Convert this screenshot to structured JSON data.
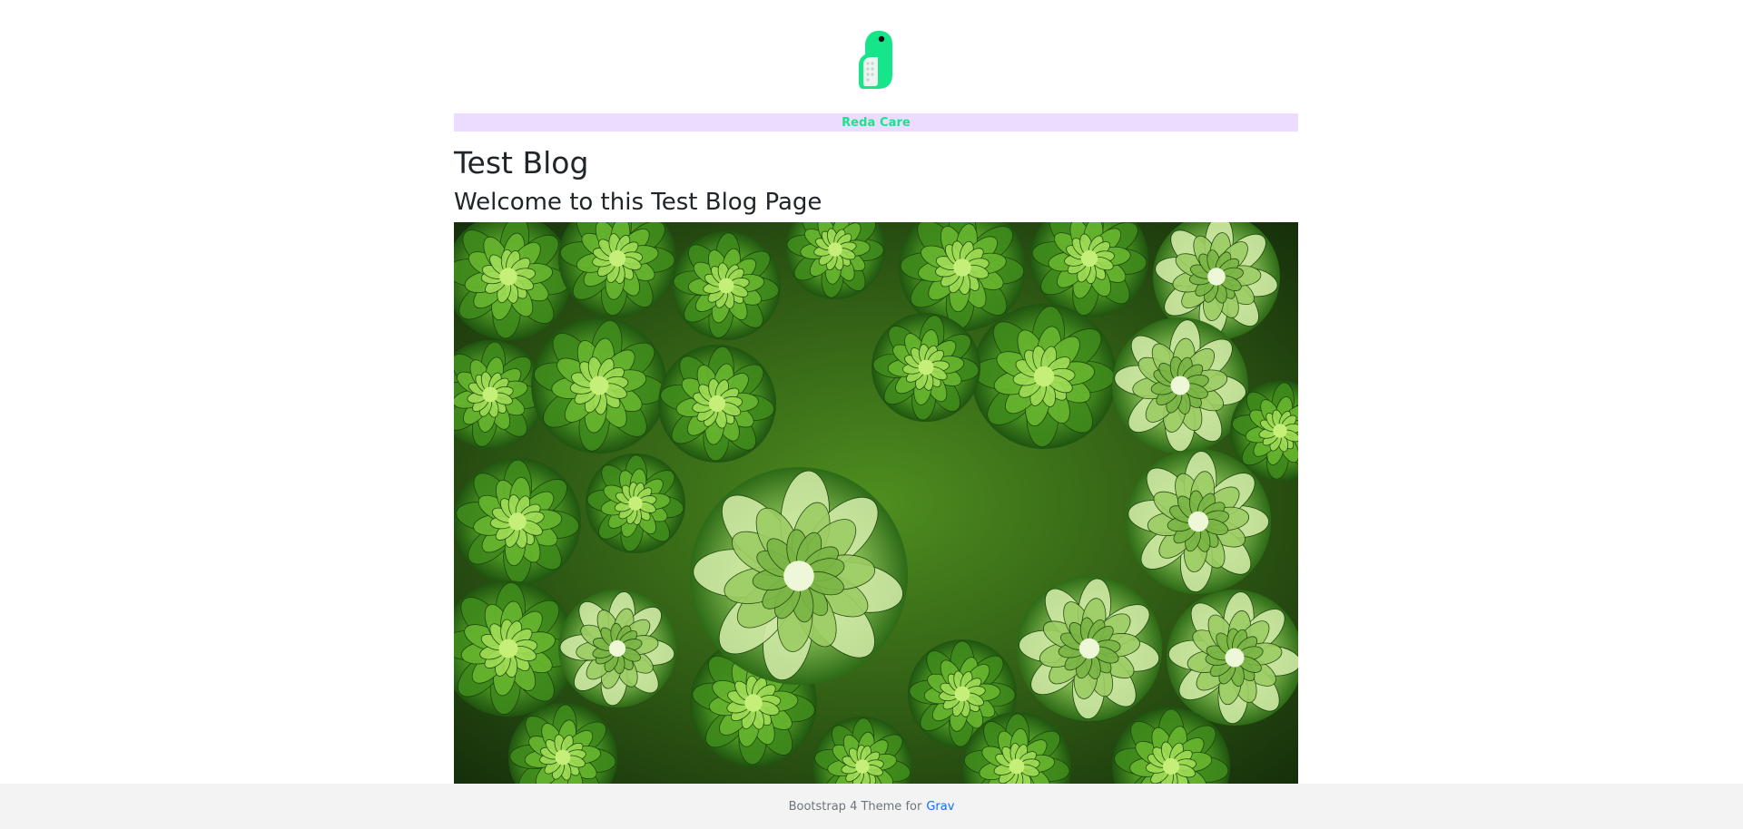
{
  "header": {
    "logo_icon": "bird-logo-icon",
    "brand_name": "Reda Care",
    "brand_color": "#16e58a",
    "brand_bar_color": "#ecdcff"
  },
  "main": {
    "title": "Test Blog",
    "subtitle": "Welcome to this Test Blog Page",
    "hero_image": "succulent-plants-photo"
  },
  "footer": {
    "text": "Bootstrap 4 Theme for",
    "link_label": "Grav",
    "link_color": "#0d6efd"
  }
}
